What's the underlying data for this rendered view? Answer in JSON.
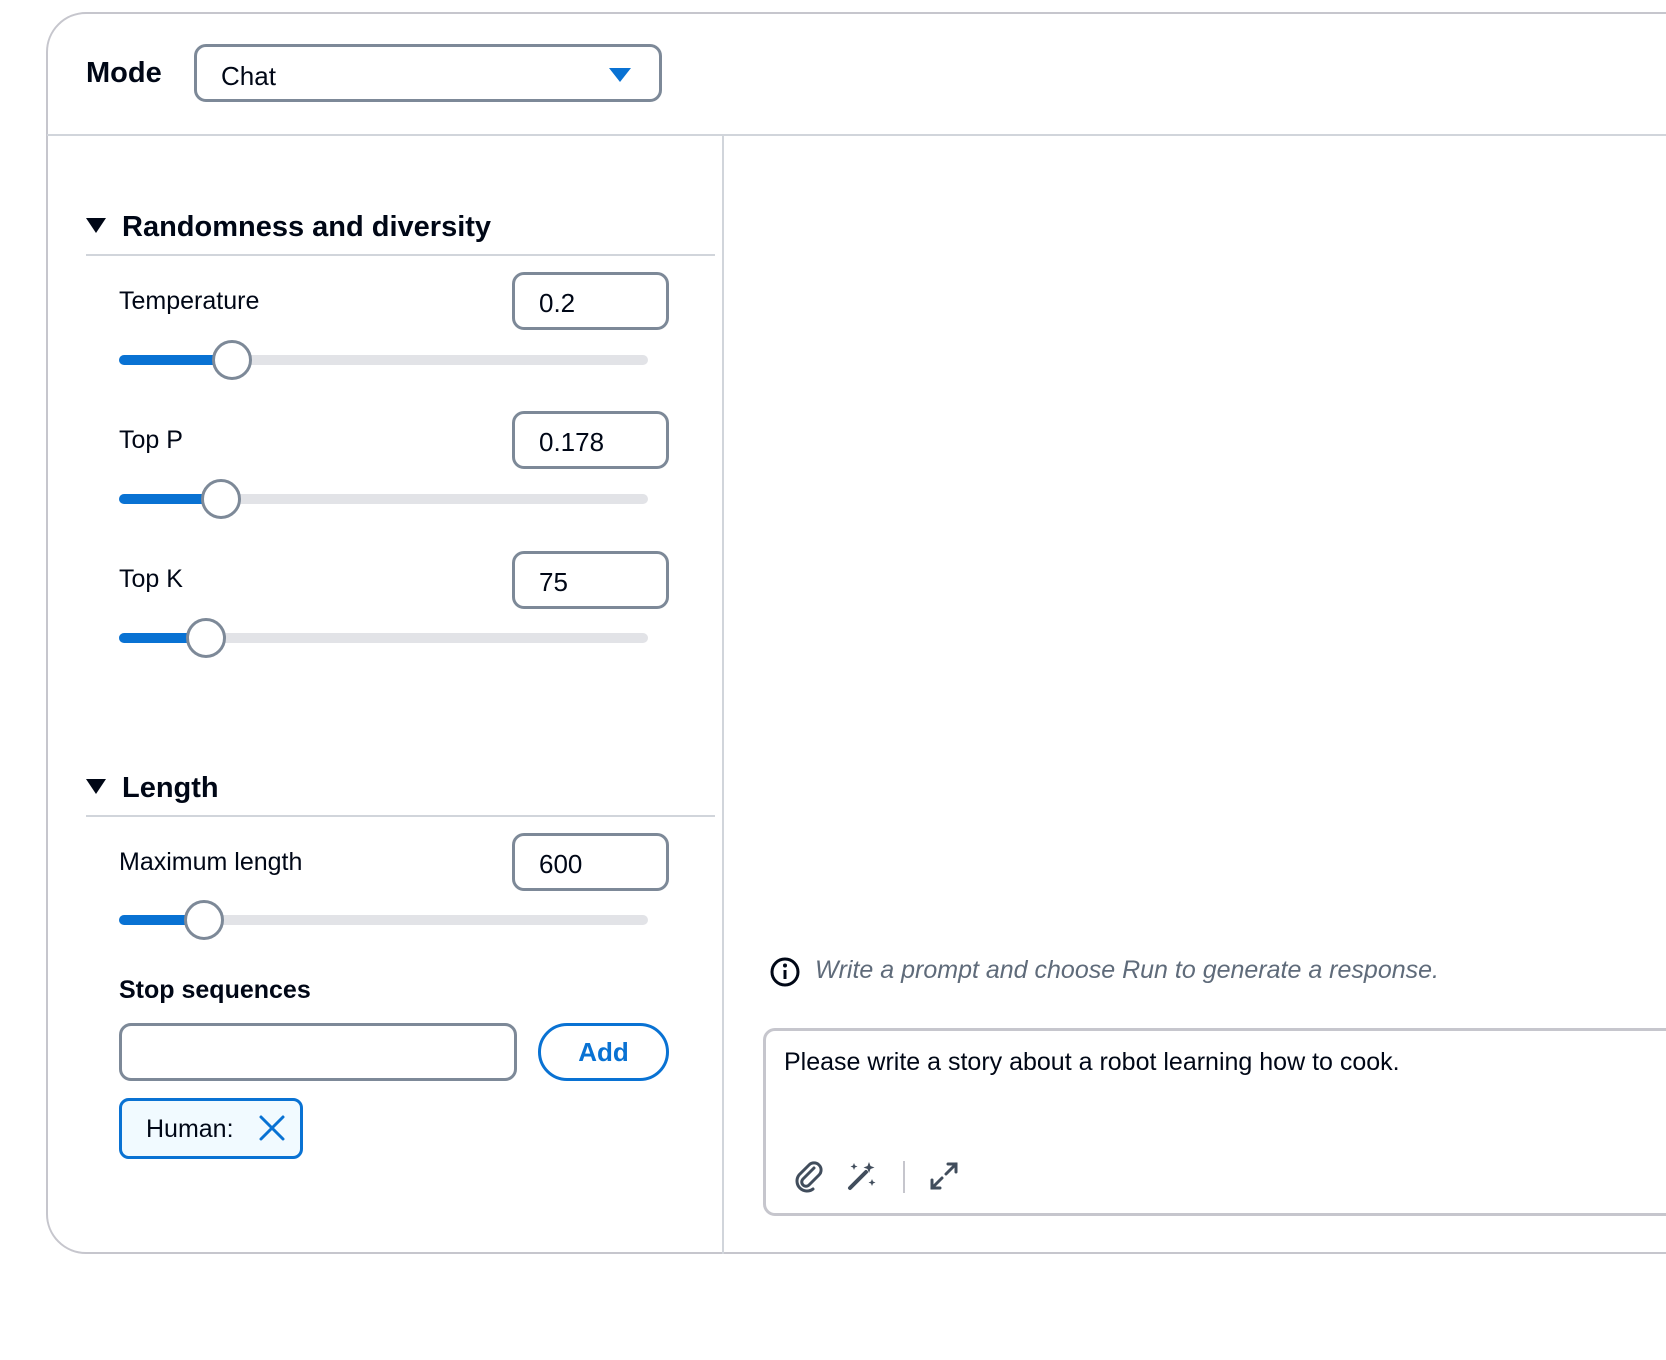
{
  "mode": {
    "label": "Mode",
    "selected": "Chat"
  },
  "randomness": {
    "title": "Randomness and diversity",
    "temperature": {
      "label": "Temperature",
      "value": "0.2",
      "fraction": 0.208
    },
    "top_p": {
      "label": "Top P",
      "value": "0.178",
      "fraction": 0.187
    },
    "top_k": {
      "label": "Top K",
      "value": "75",
      "fraction": 0.159
    }
  },
  "length": {
    "title": "Length",
    "max_length": {
      "label": "Maximum length",
      "value": "600",
      "fraction": 0.155
    }
  },
  "stop_sequences": {
    "label": "Stop sequences",
    "input_value": "",
    "add_label": "Add",
    "tokens": [
      "Human:"
    ]
  },
  "chat": {
    "hint": "Write a prompt and choose Run to generate a response.",
    "prompt": "Please write a story about a robot learning how to cook."
  },
  "colors": {
    "accent": "#0972d3",
    "border": "#7d8998",
    "track": "#e2e3e7"
  },
  "icons": [
    "chevron-down-icon",
    "caret-down-icon",
    "close-icon",
    "info-icon",
    "paperclip-icon",
    "magic-wand-icon",
    "expand-icon"
  ]
}
